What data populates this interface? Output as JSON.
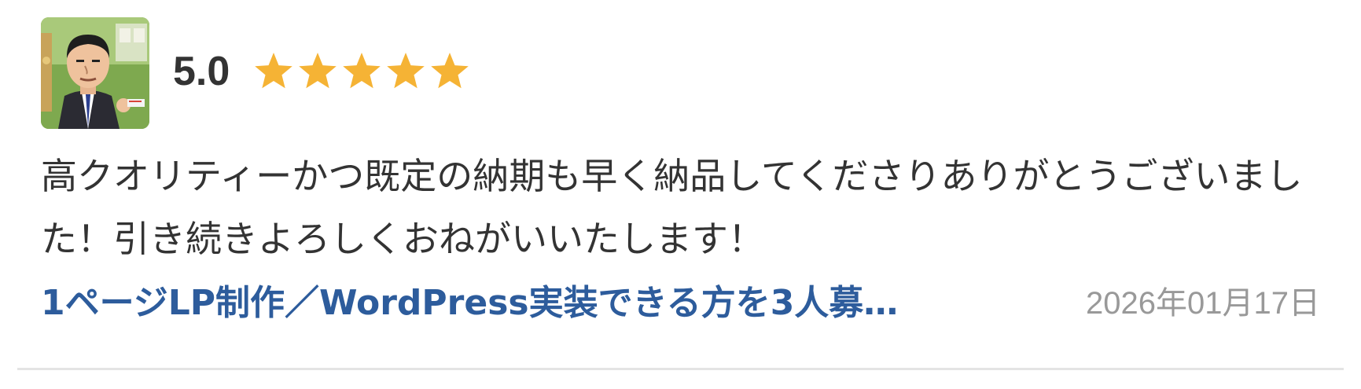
{
  "review": {
    "rating_score": "5.0",
    "rating_value": 5,
    "rating_max": 5,
    "star_color": "#f5b335",
    "comment": "高クオリティーかつ既定の納期も早く納品してくださりありがとうございました！引き続きよろしくおねがいいたします！",
    "job_title": "1ページLP制作／WordPress実装できる方を3人募…",
    "date": "2026年01月17日",
    "link_color": "#2d5c9c"
  },
  "avatar": {
    "icon": "user-avatar-cartoon-businessman"
  }
}
